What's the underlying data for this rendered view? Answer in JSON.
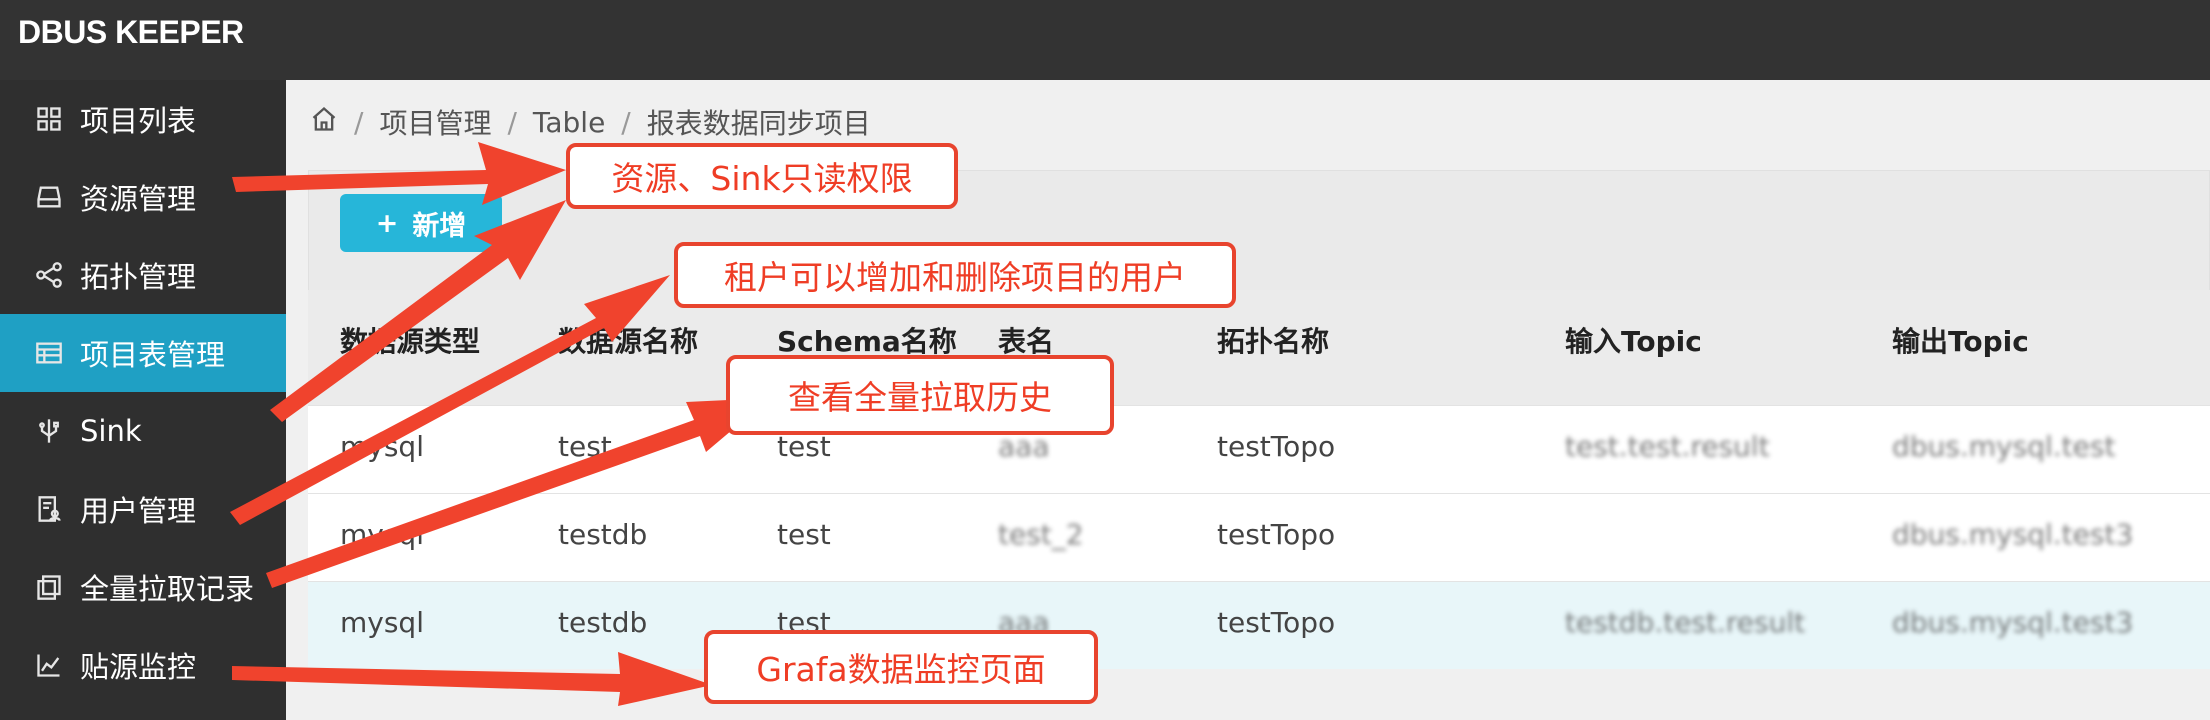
{
  "app": {
    "title": "DBUS KEEPER"
  },
  "sidebar": {
    "items": [
      {
        "label": "项目列表",
        "icon": "grid-icon"
      },
      {
        "label": "资源管理",
        "icon": "drive-icon"
      },
      {
        "label": "拓扑管理",
        "icon": "share-icon"
      },
      {
        "label": "项目表管理",
        "icon": "table-icon",
        "active": true
      },
      {
        "label": "Sink",
        "icon": "usb-icon"
      },
      {
        "label": "用户管理",
        "icon": "user-doc-icon"
      },
      {
        "label": "全量拉取记录",
        "icon": "copy-icon"
      },
      {
        "label": "贴源监控",
        "icon": "chart-icon"
      }
    ]
  },
  "breadcrumb": {
    "items": [
      "项目管理",
      "Table",
      "报表数据同步项目"
    ],
    "separator": "/"
  },
  "toolbar": {
    "add_label": "新增",
    "add_symbol": "+"
  },
  "table": {
    "columns": [
      "数据源类型",
      "数据源名称",
      "Schema名称",
      "表名",
      "拓扑名称",
      "输入Topic",
      "输出Topic"
    ],
    "rows": [
      [
        "mysql",
        "test",
        "test",
        "aaa",
        "testTopo",
        "test.test.result",
        "dbus.mysql.test"
      ],
      [
        "mysql",
        "testdb",
        "test",
        "test_2",
        "testTopo",
        "",
        "dbus.mysql.test3"
      ],
      [
        "mysql",
        "testdb",
        "test",
        "aaa",
        "testTopo",
        "testdb.test.result",
        "dbus.mysql.test3"
      ]
    ]
  },
  "callouts": {
    "readonly": "资源、Sink只读权限",
    "tenant": "租户可以增加和删除项目的用户",
    "history": "查看全量拉取历史",
    "grafana": "Grafa数据监控页面"
  },
  "colors": {
    "accent": "#26b6d9",
    "active_menu": "#1fa0c4",
    "annotation": "#e8442e",
    "topbar": "#333333"
  }
}
